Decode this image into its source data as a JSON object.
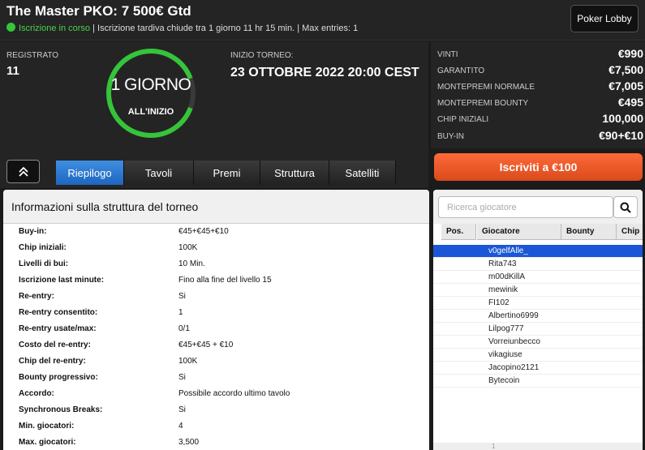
{
  "header": {
    "title": "The Master PKO: 7 500€ Gtd",
    "status_open": "Iscrizione in corso",
    "status_rest": "| Iscrizione tardiva chiude tra 1 giorno 11 hr 15 min. | Max entries: 1",
    "lobby_button": "Poker Lobby"
  },
  "info": {
    "registered_label": "REGISTRATO",
    "registered_value": "11",
    "countdown_main": "1 GIORNO",
    "countdown_sub": "ALL'INIZIO",
    "start_label": "INIZIO TORNEO:",
    "start_value": "23 OTTOBRE 2022   20:00 CEST"
  },
  "stats": [
    {
      "label": "VINTI",
      "value": "€990"
    },
    {
      "label": "GARANTITO",
      "value": "€7,500"
    },
    {
      "label": "MONTEPREMI NORMALE",
      "value": "€7,005"
    },
    {
      "label": "MONTEPREMI BOUNTY",
      "value": "€495"
    },
    {
      "label": "CHIP INIZIALI",
      "value": "100,000"
    },
    {
      "label": "BUY-IN",
      "value": "€90+€10"
    }
  ],
  "register_button": "Iscriviti a €100",
  "tabs": [
    {
      "label": "Riepilogo",
      "active": true
    },
    {
      "label": "Tavoli",
      "active": false
    },
    {
      "label": "Premi",
      "active": false
    },
    {
      "label": "Struttura",
      "active": false
    },
    {
      "label": "Satelliti",
      "active": false
    }
  ],
  "structure": {
    "heading": "Informazioni sulla struttura del torneo",
    "rows": [
      {
        "label": "Buy-in:",
        "value": "€45+€45+€10"
      },
      {
        "label": "Chip iniziali:",
        "value": "100K"
      },
      {
        "label": "Livelli di bui:",
        "value": "10 Min."
      },
      {
        "label": "Iscrizione last minute:",
        "value": "Fino alla fine del livello 15"
      },
      {
        "label": "Re-entry:",
        "value": "Si"
      },
      {
        "label": "Re-entry consentito:",
        "value": "1"
      },
      {
        "label": "Re-entry usate/max:",
        "value": "0/1"
      },
      {
        "label": "Costo del re-entry:",
        "value": "€45+€45 + €10"
      },
      {
        "label": "Chip del re-entry:",
        "value": "100K"
      },
      {
        "label": "Bounty progressivo:",
        "value": "Si"
      },
      {
        "label": "Accordo:",
        "value": "Possibile accordo ultimo tavolo"
      },
      {
        "label": "Synchronous Breaks:",
        "value": "Si"
      },
      {
        "label": "Min. giocatori:",
        "value": "4"
      },
      {
        "label": "Max. giocatori:",
        "value": "3,500"
      }
    ]
  },
  "players": {
    "search_placeholder": "Ricerca giocatore",
    "columns": [
      "Pos.",
      "Giocatore",
      "Bounty",
      "Chip"
    ],
    "list": [
      "v0gelfAlle_",
      "Rita743",
      "m00dKillA",
      "mewinik",
      "FI102",
      "Albertino6999",
      "Lilpog777",
      "Vorreiunbecco",
      "vikagiuse",
      "Jacopino2121",
      "Bytecoin"
    ],
    "selected_index": 0,
    "pager_text": "1"
  },
  "colors": {
    "accent_blue": "#1e66c0",
    "ring_green": "#35c43a",
    "register_orange": "#e8541f"
  }
}
